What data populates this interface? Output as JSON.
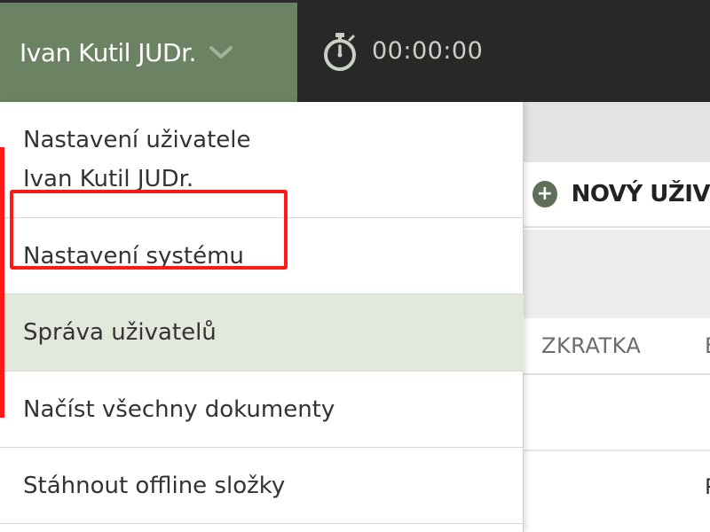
{
  "header": {
    "user_name": "Ivan Kutil JUDr.",
    "timer": "00:00:00"
  },
  "dropdown": {
    "user_settings_line1": "Nastavení uživatele",
    "user_settings_line2": "Ivan Kutil JUDr.",
    "items": [
      {
        "label": "Nastavení systému"
      },
      {
        "label": "Správa uživatelů",
        "highlighted": true
      },
      {
        "label": "Načíst všechny dokumenty"
      },
      {
        "label": "Stáhnout offline složky"
      }
    ]
  },
  "background": {
    "new_user_label": "NOVÝ UŽIV",
    "column_zkratka": "ZKRATKA",
    "column_next": "E",
    "row2_char": "P"
  },
  "colors": {
    "header_user_bg": "#6b8362",
    "header_timer_bg": "#282828",
    "selected_item_bg": "#e2e8dc",
    "annotation": "#ff1a1a"
  },
  "icons": [
    "chevron-down-icon",
    "stopwatch-icon",
    "plus-circle-icon"
  ]
}
